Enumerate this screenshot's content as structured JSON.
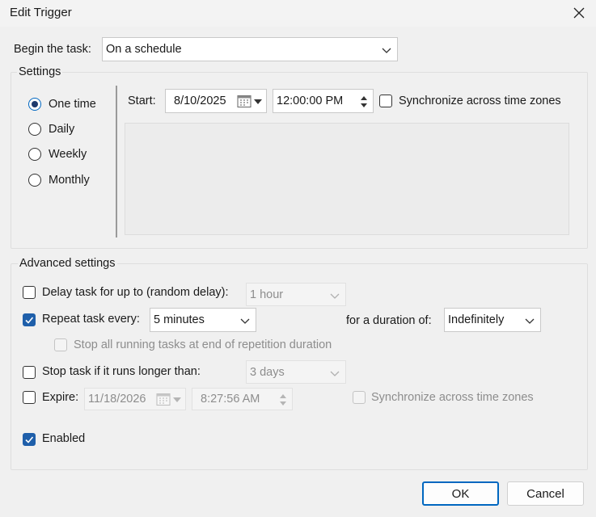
{
  "window": {
    "title": "Edit Trigger"
  },
  "begin": {
    "label": "Begin the task:",
    "value": "On a schedule"
  },
  "settings": {
    "legend": "Settings",
    "options": [
      "One time",
      "Daily",
      "Weekly",
      "Monthly"
    ],
    "selected_index": 0,
    "start_label": "Start:",
    "start_date": "8/10/2025",
    "start_time": "12:00:00 PM",
    "sync_label": "Synchronize across time zones",
    "sync_checked": false
  },
  "advanced": {
    "legend": "Advanced settings",
    "delay": {
      "label": "Delay task for up to (random delay):",
      "value": "1 hour",
      "checked": false
    },
    "repeat": {
      "label": "Repeat task every:",
      "value": "5 minutes",
      "checked": true,
      "duration_label": "for a duration of:",
      "duration_value": "Indefinitely"
    },
    "stop_running": {
      "label": "Stop all running tasks at end of repetition duration",
      "checked": false
    },
    "stop_longer": {
      "label": "Stop task if it runs longer than:",
      "value": "3 days",
      "checked": false
    },
    "expire": {
      "label": "Expire:",
      "date": "11/18/2026",
      "time": "8:27:56 AM",
      "checked": false,
      "sync_label": "Synchronize across time zones"
    },
    "enabled": {
      "label": "Enabled",
      "checked": true
    }
  },
  "buttons": {
    "ok": "OK",
    "cancel": "Cancel"
  },
  "colors": {
    "accent": "#0067c0",
    "check_fill": "#1f5faa",
    "background": "#f0f0f0"
  }
}
